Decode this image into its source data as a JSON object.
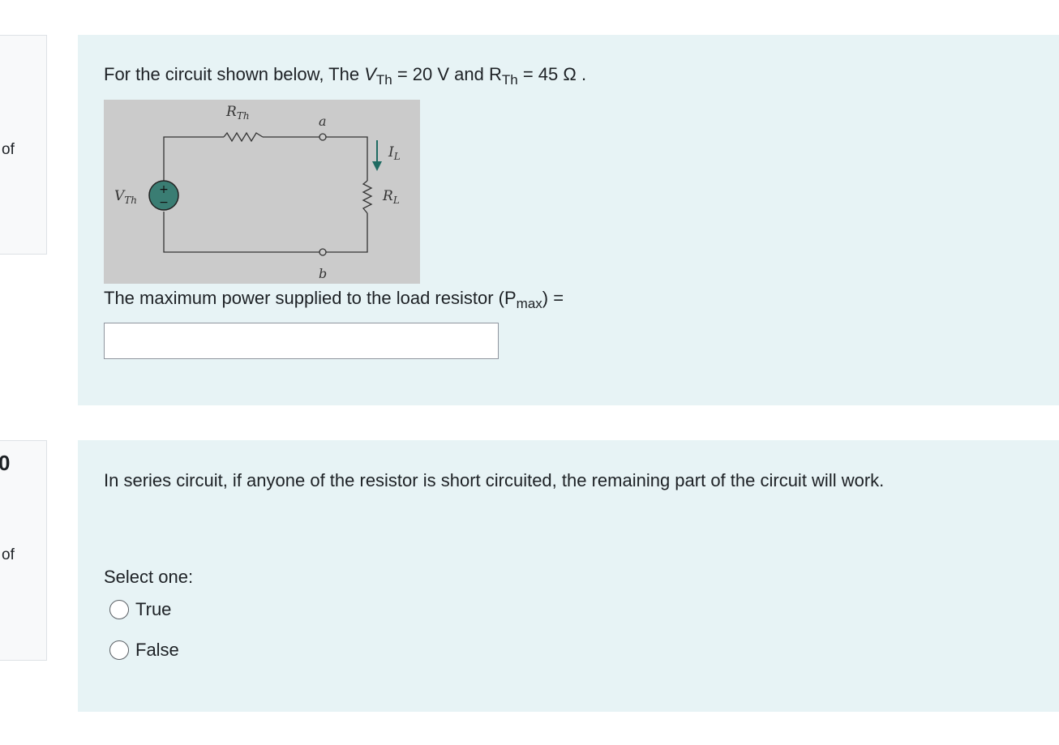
{
  "question1": {
    "info_of": "of",
    "prompt_prefix": "For the circuit shown below,   The ",
    "v_symbol": "V",
    "v_sub": "Th",
    "v_value": " = 20 V and R",
    "r_sub": "Th",
    "r_value": " = 45 Ω .",
    "circuit_labels": {
      "r_th": "R",
      "r_th_sub": "Th",
      "node_a": "a",
      "node_b": "b",
      "v_th": "V",
      "v_th_sub": "Th",
      "i_l": "I",
      "i_l_sub": "L",
      "r_l": "R",
      "r_l_sub": "L",
      "plus": "+",
      "minus": "−"
    },
    "answer_prompt": "The maximum power supplied to the load resistor (P",
    "answer_prompt_sub": "max",
    "answer_prompt_suffix": ") =",
    "answer_value": ""
  },
  "question2": {
    "number_partial": "0",
    "info_of": "of",
    "prompt": "In series circuit, if anyone of the resistor is short circuited, the remaining part of the circuit will work.",
    "select_label": "Select one:",
    "options": [
      {
        "label": "True",
        "selected": false
      },
      {
        "label": "False",
        "selected": false
      }
    ]
  },
  "colors": {
    "question_bg": "#e7f3f5",
    "circuit_bg": "#cbcbcb",
    "source_fill": "#3a7d73",
    "arrow": "#1f6b62"
  }
}
